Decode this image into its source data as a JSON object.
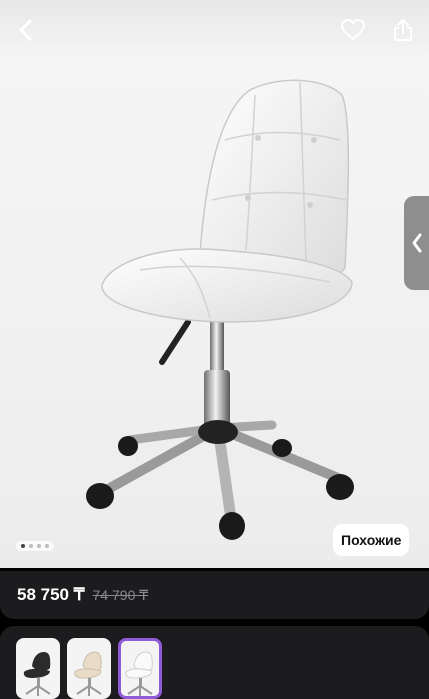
{
  "gallery": {
    "image_alt": "white office chair",
    "dots_total": 4,
    "active_index": 0,
    "similar_label": "Похожие"
  },
  "price": {
    "current": "58 750 ₸",
    "old": "74 790 ₸"
  },
  "variants": [
    {
      "color": "#2b2b2b",
      "name": "black"
    },
    {
      "color": "#e8dcc8",
      "name": "beige"
    },
    {
      "color": "#f5f5f5",
      "name": "white"
    }
  ],
  "selected_variant": 2
}
